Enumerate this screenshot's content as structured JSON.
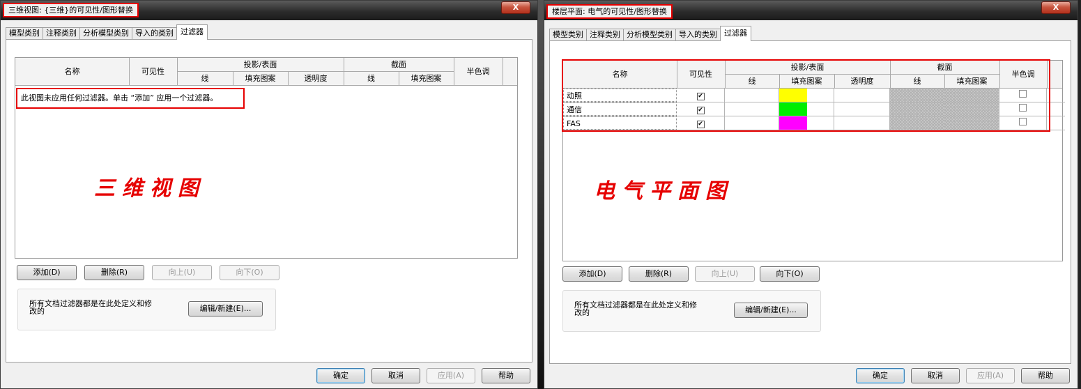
{
  "left_dialog": {
    "title": "三维视图: {三维}的可见性/图形替换",
    "close_label": "X",
    "tabs": [
      "模型类别",
      "注释类别",
      "分析模型类别",
      "导入的类别",
      "过滤器"
    ],
    "active_tab": "过滤器",
    "grid_headers": {
      "name": "名称",
      "visibility": "可见性",
      "projection_surface": "投影/表面",
      "line": "线",
      "fill_pattern": "填充图案",
      "transparency": "透明度",
      "cut": "截面",
      "cut_line": "线",
      "cut_fill_pattern": "填充图案",
      "halftone": "半色调"
    },
    "empty_message": "此视图未应用任何过滤器。单击 “添加” 应用一个过滤器。",
    "annotation": "三维视图",
    "buttons": {
      "add": "添加(D)",
      "delete": "删除(R)",
      "up": "向上(U)",
      "down": "向下(O)",
      "edit_new": "编辑/新建(E)...",
      "ok": "确定",
      "cancel": "取消",
      "apply": "应用(A)",
      "help": "帮助"
    },
    "group_text": "所有文档过滤器都是在此处定义和修改的"
  },
  "right_dialog": {
    "title": "楼层平面: 电气的可见性/图形替换",
    "close_label": "X",
    "tabs": [
      "模型类别",
      "注释类别",
      "分析模型类别",
      "导入的类别",
      "过滤器"
    ],
    "active_tab": "过滤器",
    "grid_headers": {
      "name": "名称",
      "visibility": "可见性",
      "projection_surface": "投影/表面",
      "line": "线",
      "fill_pattern": "填充图案",
      "transparency": "透明度",
      "cut": "截面",
      "cut_line": "线",
      "cut_fill_pattern": "填充图案",
      "halftone": "半色调"
    },
    "filters": [
      {
        "name": "动照",
        "visible": true,
        "fill_color": "#ffff00",
        "halftone": false
      },
      {
        "name": "通信",
        "visible": true,
        "fill_color": "#00ee00",
        "halftone": false
      },
      {
        "name": "FAS",
        "visible": true,
        "fill_color": "#ff00ff",
        "halftone": false
      }
    ],
    "annotation": "电气平面图",
    "buttons": {
      "add": "添加(D)",
      "delete": "删除(R)",
      "up": "向上(U)",
      "down": "向下(O)",
      "edit_new": "编辑/新建(E)...",
      "ok": "确定",
      "cancel": "取消",
      "apply": "应用(A)",
      "help": "帮助"
    },
    "group_text": "所有文档过滤器都是在此处定义和修改的"
  },
  "colors": {
    "highlight_red": "#e60000"
  }
}
